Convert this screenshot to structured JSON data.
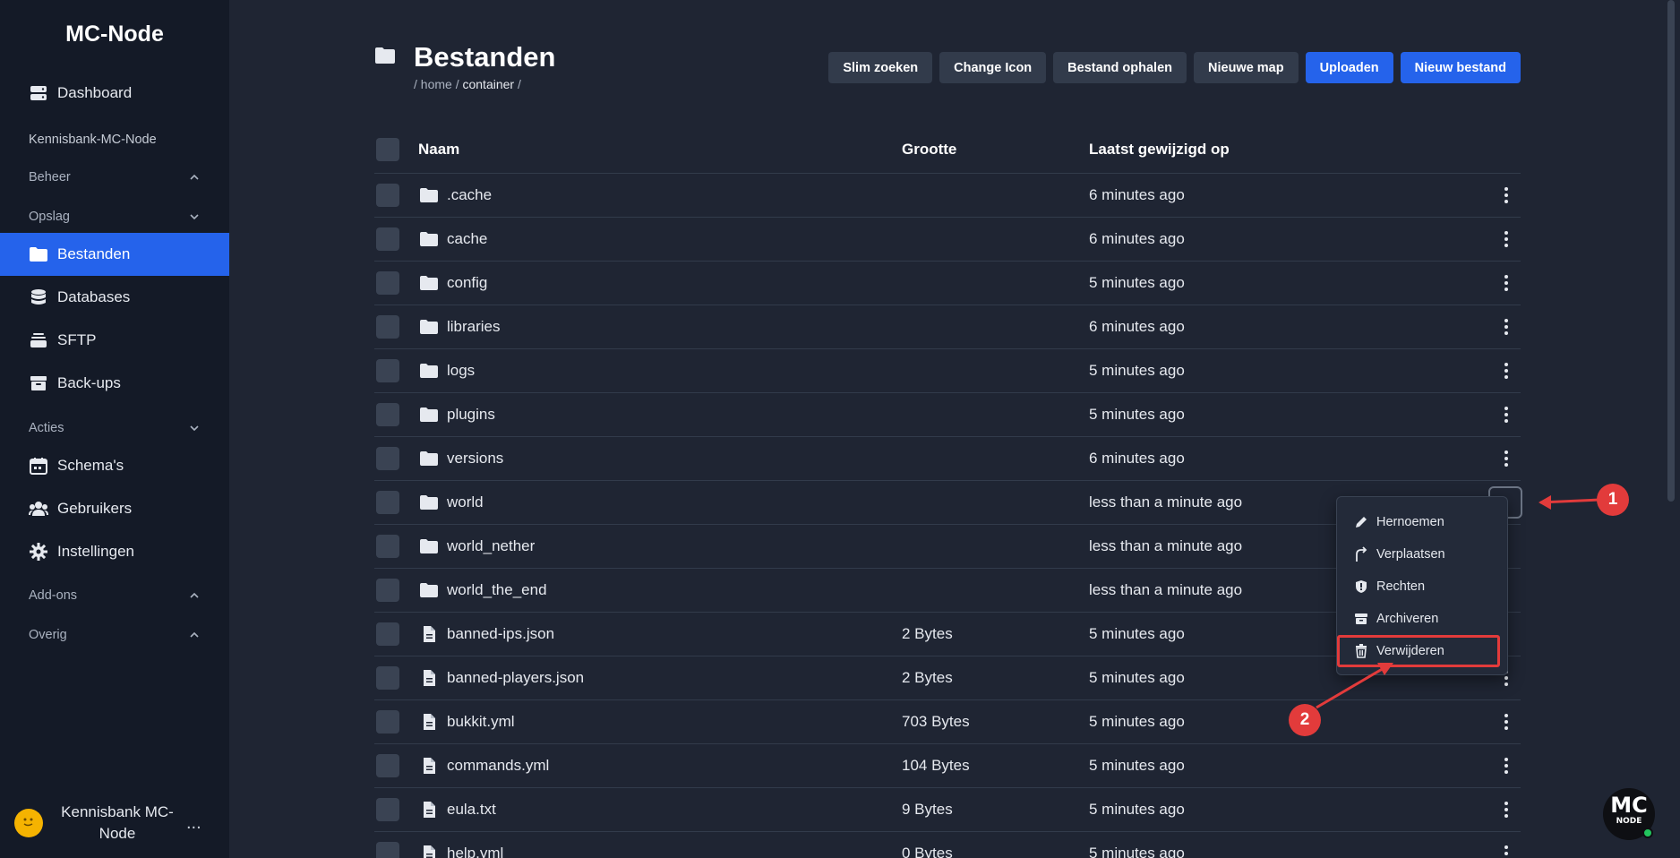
{
  "sidebar": {
    "brand": "MC-Node",
    "dashboard": "Dashboard",
    "server_name": "Kennisbank-MC-Node",
    "sections": {
      "beheer": "Beheer",
      "opslag": "Opslag",
      "acties": "Acties",
      "addons": "Add-ons",
      "overig": "Overig"
    },
    "items": {
      "bestanden": "Bestanden",
      "databases": "Databases",
      "sftp": "SFTP",
      "backups": "Back-ups",
      "schemas": "Schema's",
      "gebruikers": "Gebruikers",
      "instellingen": "Instellingen"
    },
    "user": {
      "name": "Kennisbank MC-Node",
      "more": "..."
    }
  },
  "header": {
    "title": "Bestanden",
    "breadcrumb": {
      "sep1": "/ ",
      "home": "home",
      "sep2": " / ",
      "container": "container",
      "sep3": " /"
    }
  },
  "toolbar": {
    "slim_zoeken": "Slim zoeken",
    "change_icon": "Change Icon",
    "bestand_ophalen": "Bestand ophalen",
    "nieuwe_map": "Nieuwe map",
    "uploaden": "Uploaden",
    "nieuw_bestand": "Nieuw bestand"
  },
  "table": {
    "columns": {
      "name": "Naam",
      "size": "Grootte",
      "modified": "Laatst gewijzigd op"
    },
    "rows": [
      {
        "type": "folder",
        "name": ".cache",
        "size": "",
        "modified": "6 minutes ago"
      },
      {
        "type": "folder",
        "name": "cache",
        "size": "",
        "modified": "6 minutes ago"
      },
      {
        "type": "folder",
        "name": "config",
        "size": "",
        "modified": "5 minutes ago"
      },
      {
        "type": "folder",
        "name": "libraries",
        "size": "",
        "modified": "6 minutes ago"
      },
      {
        "type": "folder",
        "name": "logs",
        "size": "",
        "modified": "5 minutes ago"
      },
      {
        "type": "folder",
        "name": "plugins",
        "size": "",
        "modified": "5 minutes ago"
      },
      {
        "type": "folder",
        "name": "versions",
        "size": "",
        "modified": "6 minutes ago"
      },
      {
        "type": "folder",
        "name": "world",
        "size": "",
        "modified": "less than a minute ago"
      },
      {
        "type": "folder",
        "name": "world_nether",
        "size": "",
        "modified": "less than a minute ago"
      },
      {
        "type": "folder",
        "name": "world_the_end",
        "size": "",
        "modified": "less than a minute ago"
      },
      {
        "type": "file",
        "name": "banned-ips.json",
        "size": "2 Bytes",
        "modified": "5 minutes ago"
      },
      {
        "type": "file",
        "name": "banned-players.json",
        "size": "2 Bytes",
        "modified": "5 minutes ago"
      },
      {
        "type": "file",
        "name": "bukkit.yml",
        "size": "703 Bytes",
        "modified": "5 minutes ago"
      },
      {
        "type": "file",
        "name": "commands.yml",
        "size": "104 Bytes",
        "modified": "5 minutes ago"
      },
      {
        "type": "file",
        "name": "eula.txt",
        "size": "9 Bytes",
        "modified": "5 minutes ago"
      },
      {
        "type": "file",
        "name": "help.yml",
        "size": "0 Bytes",
        "modified": "5 minutes ago"
      }
    ]
  },
  "context_menu": {
    "hernoemen": "Hernoemen",
    "verplaatsen": "Verplaatsen",
    "rechten": "Rechten",
    "archiveren": "Archiveren",
    "verwijderen": "Verwijderen"
  },
  "annotations": {
    "step1": "1",
    "step2": "2"
  },
  "logo": {
    "line1": "MC",
    "line2": "NODE"
  },
  "colors": {
    "accent": "#2563eb",
    "annotation": "#e23b3b",
    "sidebar_bg": "#141a27",
    "main_bg": "#1f2533"
  }
}
